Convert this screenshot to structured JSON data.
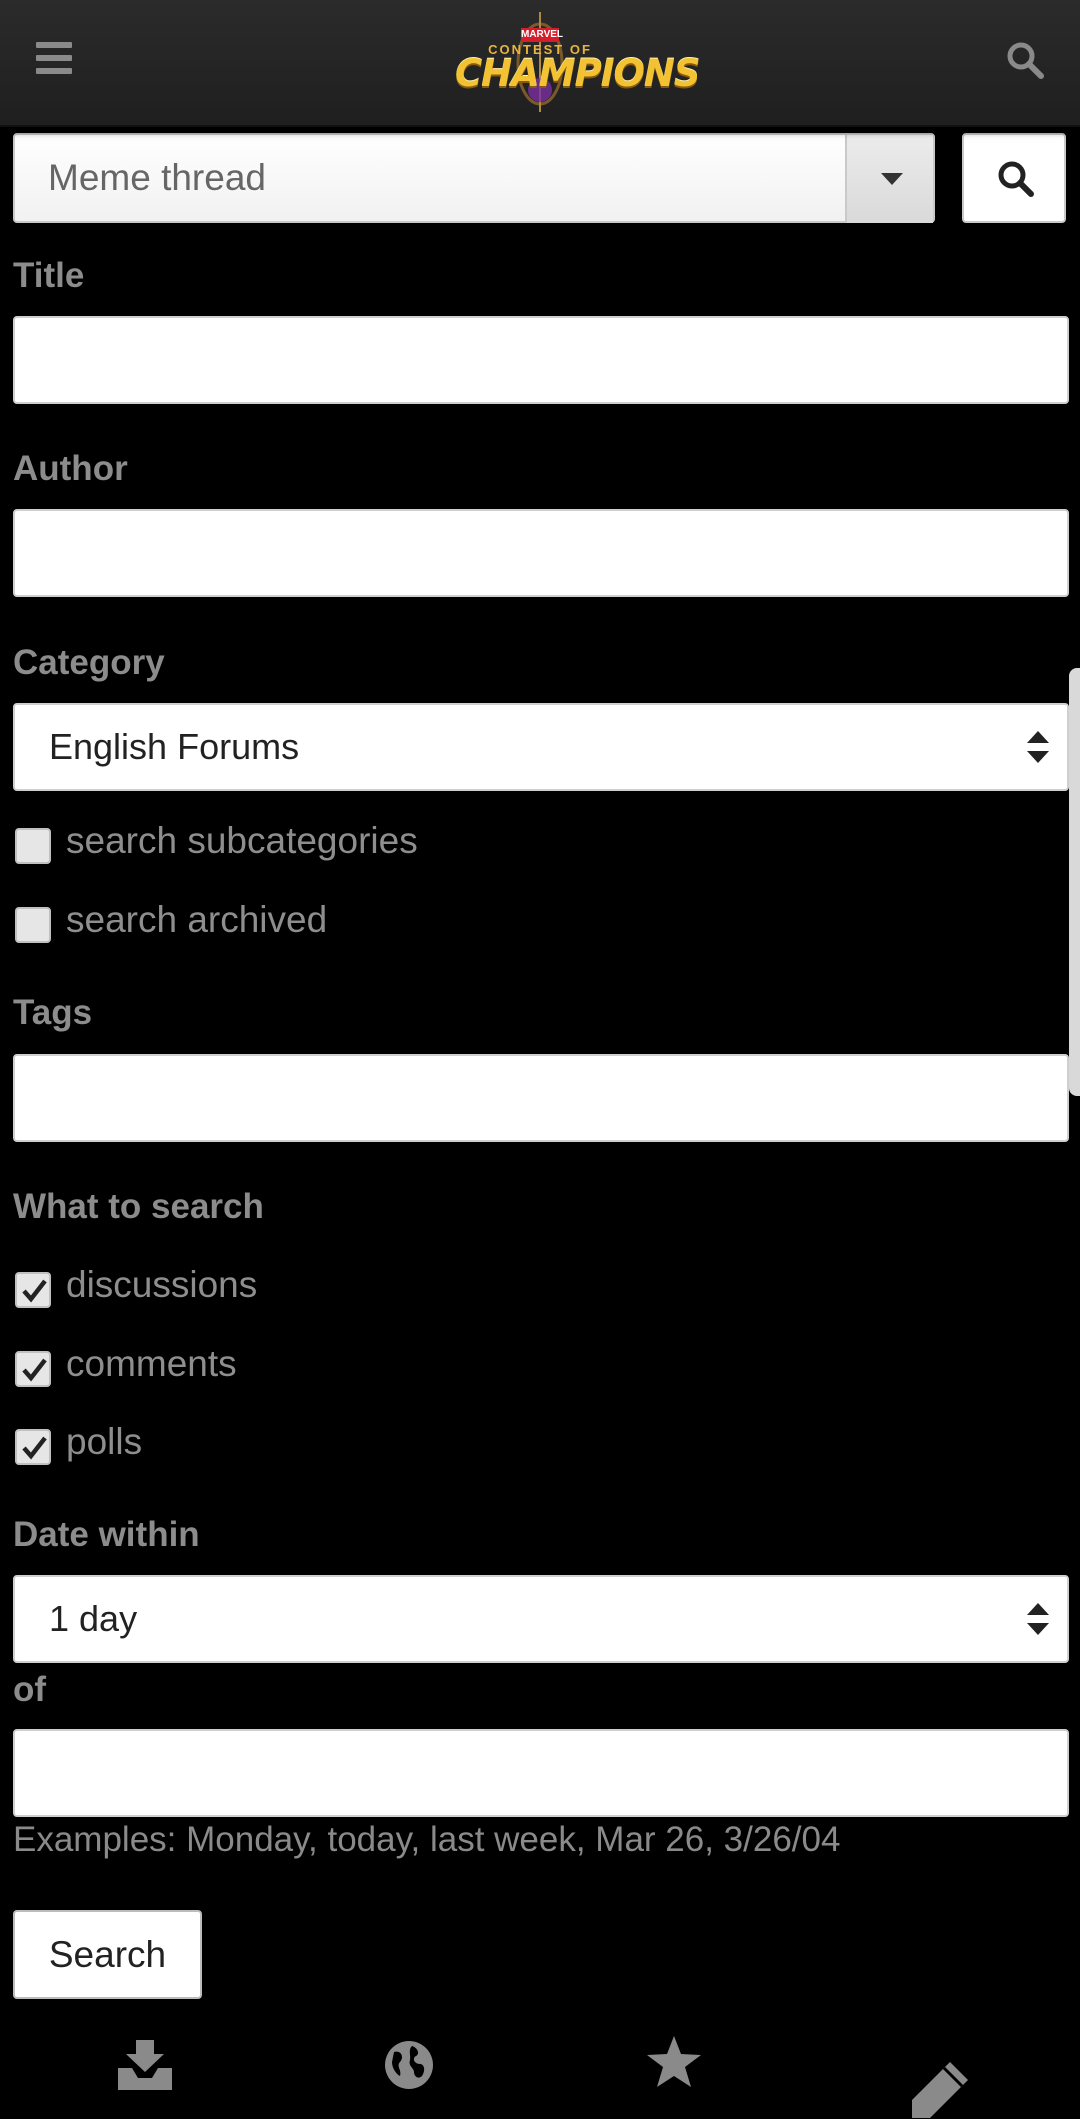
{
  "header": {
    "logo": {
      "brand": "MARVEL",
      "line1": "CONTEST OF",
      "line2": "CHAMPIONS"
    },
    "menu_icon": "hamburger-icon",
    "search_icon": "search-icon"
  },
  "quick_search": {
    "value": "Meme thread",
    "dropdown_icon": "caret-down-icon",
    "button_icon": "search-icon"
  },
  "form": {
    "title": {
      "label": "Title",
      "value": ""
    },
    "author": {
      "label": "Author",
      "value": ""
    },
    "category": {
      "label": "Category",
      "selected": "English Forums"
    },
    "options": {
      "subcategories": {
        "label": "search subcategories",
        "checked": false
      },
      "archived": {
        "label": "search archived",
        "checked": false
      }
    },
    "tags": {
      "label": "Tags",
      "value": ""
    },
    "what_to_search": {
      "label": "What to search",
      "discussions": {
        "label": "discussions",
        "checked": true
      },
      "comments": {
        "label": "comments",
        "checked": true
      },
      "polls": {
        "label": "polls",
        "checked": true
      }
    },
    "date_within": {
      "label": "Date within",
      "selected": "1 day"
    },
    "of": {
      "label": "of",
      "value": ""
    },
    "examples": "Examples: Monday, today, last week, Mar 26, 3/26/04",
    "submit_label": "Search"
  },
  "bottom_nav": [
    {
      "icon": "inbox-download-icon"
    },
    {
      "icon": "globe-icon"
    },
    {
      "icon": "star-icon"
    },
    {
      "icon": "pencil-icon"
    }
  ],
  "colors": {
    "background": "#000000",
    "label": "#8c8c8c",
    "topbar": "#262626",
    "logo_gold": "#f2c232"
  }
}
